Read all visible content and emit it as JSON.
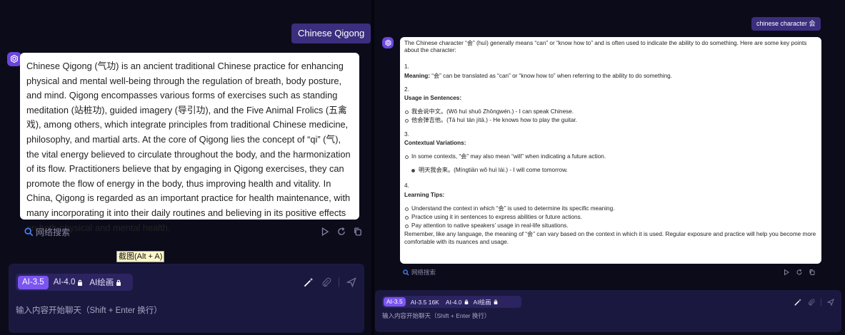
{
  "left": {
    "user_message": "Chinese Qigong",
    "response": "Chinese Qigong (气功) is an ancient traditional Chinese practice for enhancing physical and mental well-being through the regulation of breath, body posture, and mind. Qigong encompasses various forms of exercises such as standing meditation (站桩功), guided imagery (导引功), and the Five Animal Frolics (五禽戏), among others, which integrate principles from traditional Chinese medicine, philosophy, and martial arts. At the core of Qigong lies the concept of “qi” (气), the vital energy believed to circulate throughout the body, and the harmonization of its flow. Practitioners believe that by engaging in Qigong exercises, they can promote the flow of energy in the body, thus improving health and vitality. In China, Qigong is regarded as an important practice for health maintenance, with many incorporating it into their daily routines and believing in its positive effects on both physical and mental health.",
    "search_label": "网络搜索",
    "tooltip": "截图(Alt + A)",
    "models": [
      "AI-3.5",
      "AI-4.0",
      "AI绘画"
    ],
    "input_placeholder": "输入内容开始聊天（Shift + Enter 换行）"
  },
  "right": {
    "user_message": "chinese character 会",
    "intro": "The Chinese character “会” (huì) generally means “can” or “know how to” and is often used to indicate the ability to do something. Here are some key points about the character:",
    "sections": [
      {
        "num": "1.",
        "heading": "Meaning",
        "text": "“会” can be translated as “can” or “know how to” when referring to the ability to do something."
      },
      {
        "num": "2.",
        "heading": "Usage in Sentences",
        "bullets": [
          "我会说中文。(Wǒ huì shuō Zhōngwén.) - I can speak Chinese.",
          "他会弹吉他。(Tā huì tán jítā.) - He knows how to play the guitar."
        ]
      },
      {
        "num": "3.",
        "heading": "Contextual Variations",
        "bullets": [
          "In some contexts, “会” may also mean “will” when indicating a future action."
        ],
        "sub_bullets": [
          "明天我会来。(Míngtiān wǒ huì lái.) - I will come tomorrow."
        ]
      },
      {
        "num": "4.",
        "heading": "Learning Tips",
        "bullets": [
          "Understand the context in which “会” is used to determine its specific meaning.",
          "Practice using it in sentences to express abilities or future actions.",
          "Pay attention to native speakers’ usage in real-life situations."
        ]
      }
    ],
    "closing": "Remember, like any language, the meaning of “会” can vary based on the context in which it is used. Regular exposure and practice will help you become more comfortable with its nuances and usage.",
    "search_label": "网络搜索",
    "models": [
      "AI-3.5",
      "AI-3.5 16K",
      "AI-4.0",
      "AI绘画"
    ],
    "input_placeholder": "输入内容开始聊天（Shift + Enter 换行）"
  },
  "icons": {
    "avatar": "openai-logo-icon",
    "search": "search-icon",
    "play": "play-icon",
    "refresh": "refresh-icon",
    "copy": "copy-icon",
    "lock": "lock-icon",
    "magic": "magic-wand-icon",
    "attach": "paperclip-icon",
    "send": "send-icon"
  },
  "colors": {
    "background": "#0c0b1a",
    "accent": "#7b55f0",
    "user_bubble": "#3b2e7e",
    "input_box": "#1b1840",
    "search_icon": "#4a86ff"
  }
}
